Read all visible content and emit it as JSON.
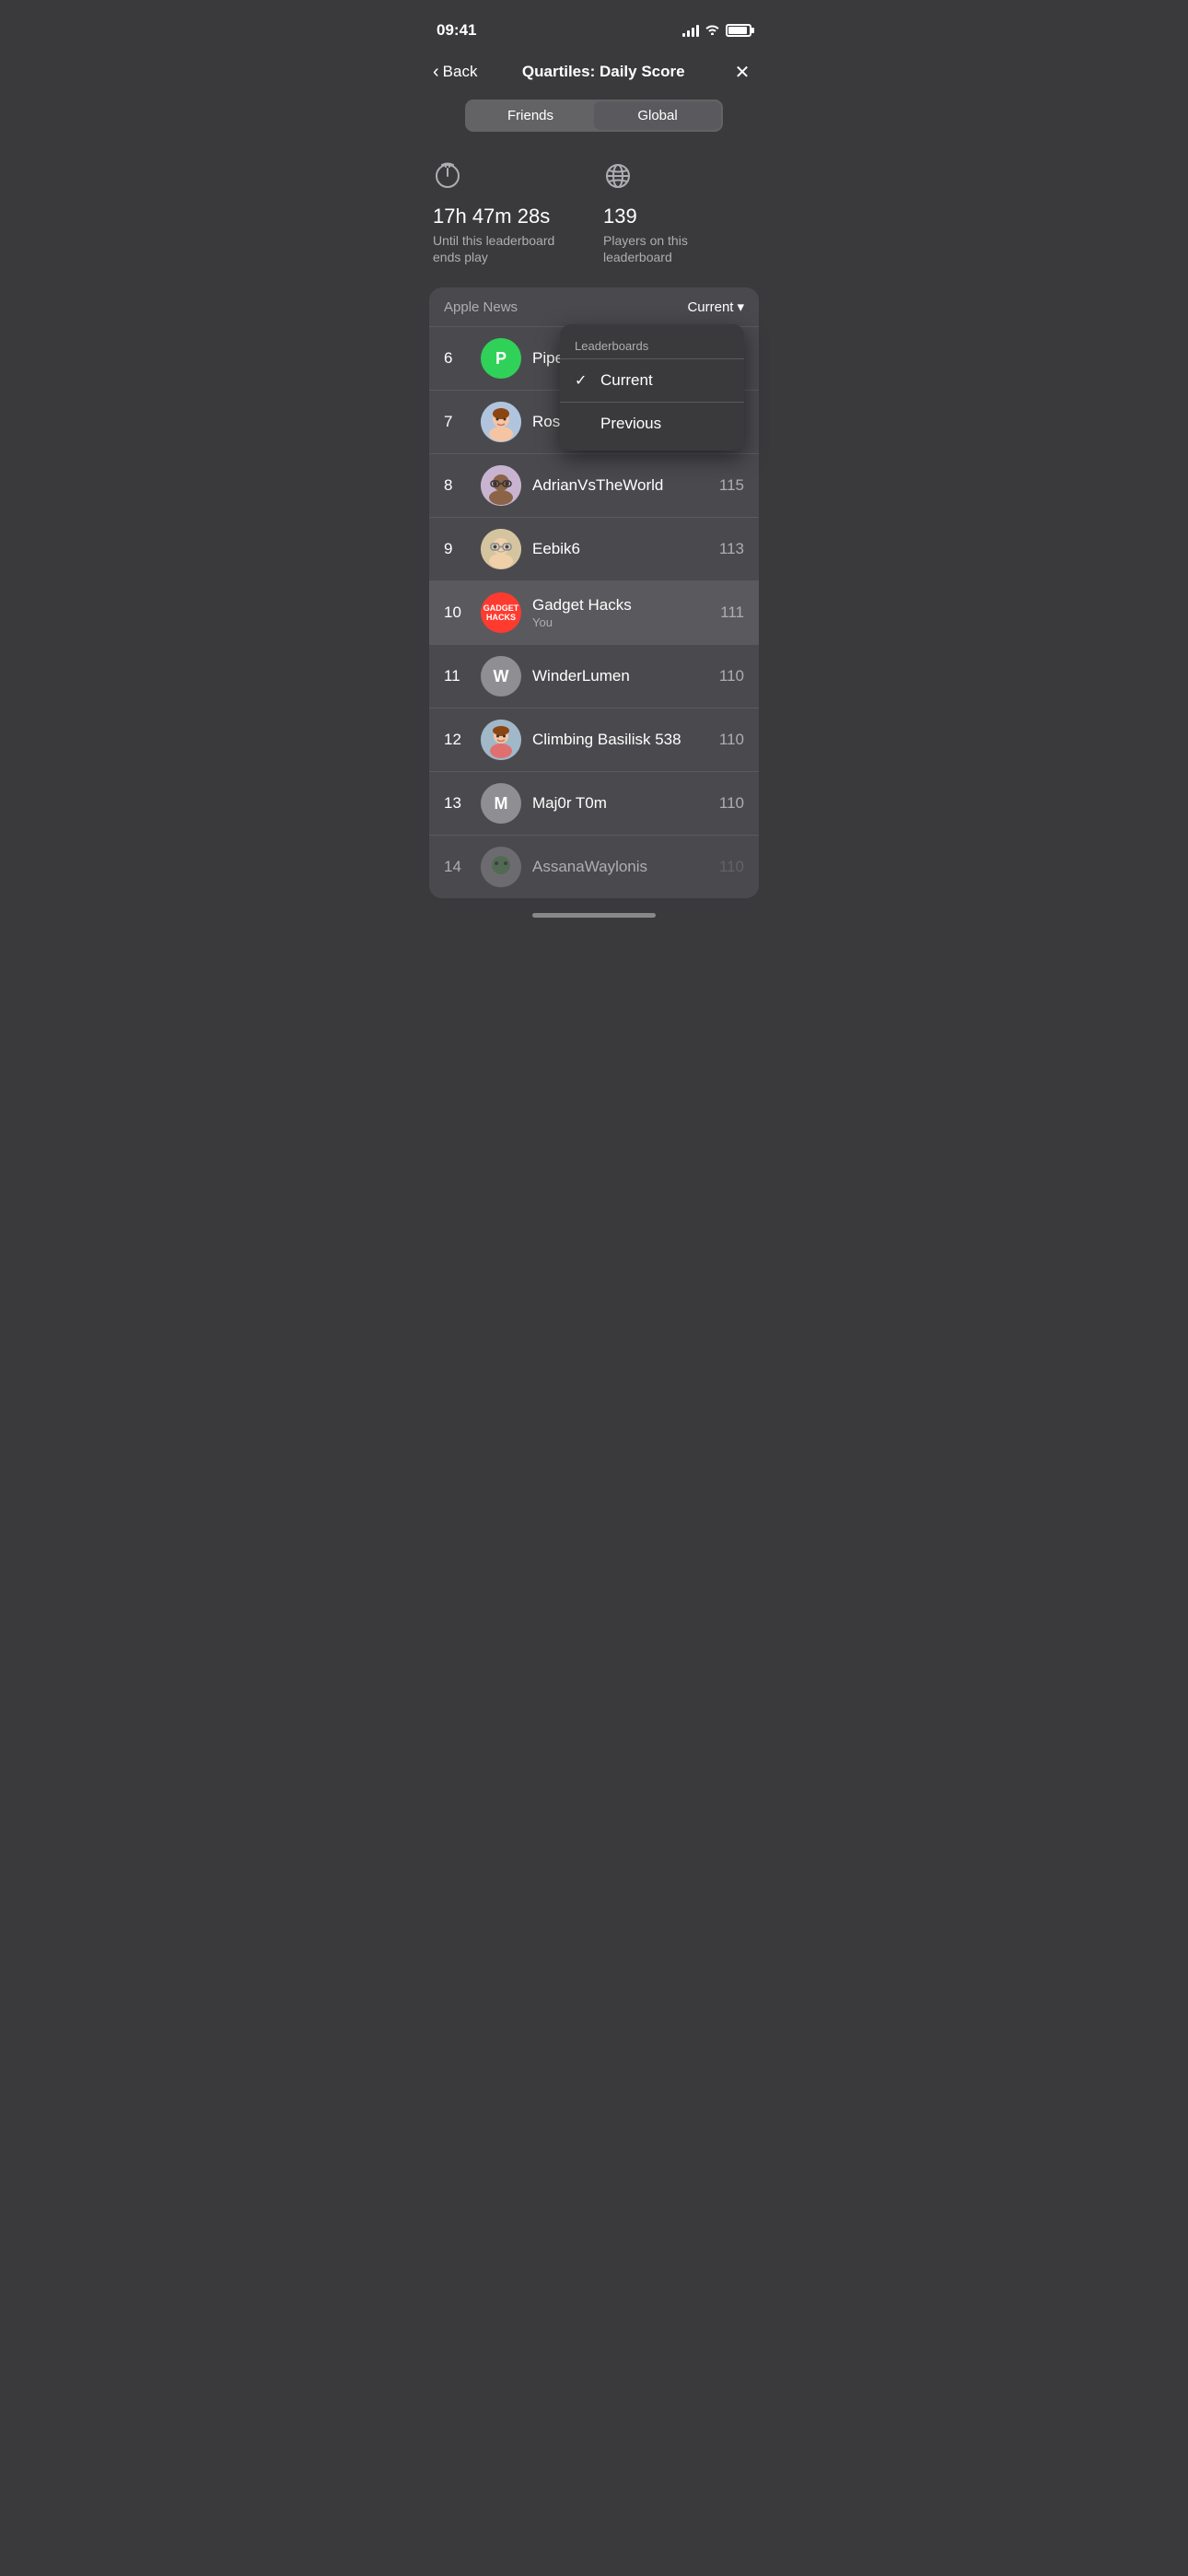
{
  "statusBar": {
    "time": "09:41"
  },
  "nav": {
    "backLabel": "Back",
    "title": "Quartiles: Daily Score",
    "closeLabel": "✕"
  },
  "segments": {
    "options": [
      "Friends",
      "Global"
    ],
    "activeIndex": 1
  },
  "stats": {
    "timer": {
      "iconLabel": "timer-icon",
      "value": "17h 47m 28s",
      "label": "Until this leaderboard\nends play"
    },
    "players": {
      "iconLabel": "globe-icon",
      "value": "139",
      "label": "Players on this leaderboard"
    }
  },
  "leaderboard": {
    "source": "Apple News",
    "filterLabel": "Current",
    "chevronLabel": "▾",
    "dropdown": {
      "sectionLabel": "Leaderboards",
      "items": [
        {
          "label": "Current",
          "checked": true
        },
        {
          "label": "Previous",
          "checked": false
        }
      ]
    },
    "players": [
      {
        "rank": "6",
        "name": "PipeD",
        "subtitle": "",
        "score": "",
        "avatarType": "letter",
        "avatarLetter": "P",
        "avatarClass": "avatar-green",
        "faded": false,
        "highlighted": false,
        "scoreVisible": false
      },
      {
        "rank": "7",
        "name": "Rossv",
        "subtitle": "",
        "score": "",
        "avatarType": "memoji1",
        "avatarLetter": "",
        "avatarClass": "avatar-memoji-1",
        "faded": false,
        "highlighted": false,
        "scoreVisible": false
      },
      {
        "rank": "8",
        "name": "AdrianVsTheWorld",
        "subtitle": "",
        "score": "115",
        "avatarType": "memoji2",
        "avatarLetter": "",
        "avatarClass": "avatar-memoji-2",
        "faded": false,
        "highlighted": false,
        "scoreVisible": true
      },
      {
        "rank": "9",
        "name": "Eebik6",
        "subtitle": "",
        "score": "113",
        "avatarType": "memoji3",
        "avatarLetter": "",
        "avatarClass": "avatar-memoji-3",
        "faded": false,
        "highlighted": false,
        "scoreVisible": true
      },
      {
        "rank": "10",
        "name": "Gadget Hacks",
        "subtitle": "You",
        "score": "111",
        "avatarType": "gadget",
        "avatarLetter": "",
        "avatarClass": "avatar-gadget",
        "faded": false,
        "highlighted": true,
        "scoreVisible": true
      },
      {
        "rank": "11",
        "name": "WinderLumen",
        "subtitle": "",
        "score": "110",
        "avatarType": "letter",
        "avatarLetter": "W",
        "avatarClass": "avatar-gray",
        "faded": false,
        "highlighted": false,
        "scoreVisible": true
      },
      {
        "rank": "12",
        "name": "Climbing Basilisk 538",
        "subtitle": "",
        "score": "110",
        "avatarType": "climbing",
        "avatarLetter": "",
        "avatarClass": "avatar-climbing",
        "faded": false,
        "highlighted": false,
        "scoreVisible": true
      },
      {
        "rank": "13",
        "name": "Maj0r T0m",
        "subtitle": "",
        "score": "110",
        "avatarType": "letter",
        "avatarLetter": "M",
        "avatarClass": "avatar-memoji-m",
        "faded": false,
        "highlighted": false,
        "scoreVisible": true
      },
      {
        "rank": "14",
        "name": "AssanaWaylonis",
        "subtitle": "",
        "score": "110",
        "avatarType": "assana",
        "avatarLetter": "",
        "avatarClass": "avatar-assana",
        "faded": true,
        "highlighted": false,
        "scoreVisible": true
      }
    ]
  }
}
